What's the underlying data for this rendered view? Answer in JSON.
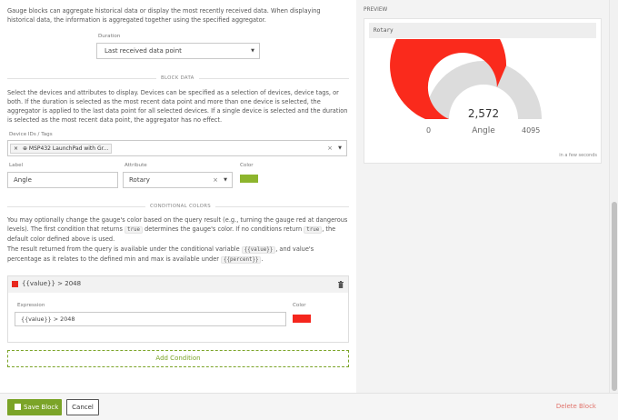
{
  "intro": {
    "text": "Gauge blocks can aggregate historical data or display the most recently received data. When displaying historical data, the information is aggregated together using the specified aggregator."
  },
  "duration": {
    "label": "Duration",
    "value": "Last received data point"
  },
  "block_data": {
    "heading": "BLOCK DATA",
    "description": "Select the devices and attributes to display. Devices can be specified as a selection of devices, device tags, or both. If the duration is selected as the most recent data point and more than one device is selected, the aggregator is applied to the last data point for all selected devices. If a single device is selected and the duration is selected as the most recent data point, the aggregator has no effect.",
    "device_label": "Device IDs / Tags",
    "device_tag_remove": "×",
    "device_tag_icon": "⊕",
    "device_tag": "MSP432 LaunchPad with Gr...",
    "clear_glyph": "×",
    "caret_glyph": "▼",
    "label_label": "Label",
    "label_value": "Angle",
    "attribute_label": "Attribute",
    "attribute_value": "Rotary",
    "color_label": "Color",
    "color": "#8db52d"
  },
  "conditional_colors": {
    "heading": "CONDITIONAL COLORS",
    "p1": {
      "a": "You may optionally change the gauge's color based on the query result (e.g., turning the gauge red at dangerous levels). The first condition that returns ",
      "code1": "true",
      "b": " determines the gauge's color. If no conditions return ",
      "code2": "true",
      "c": ", the default color defined above is used."
    },
    "p2": {
      "a": "The result returned from the query is available under the conditional variable ",
      "code1": "{{value}}",
      "b": ", and value's percentage as it relates to the defined min and max is available under ",
      "code2": "{{percent}}",
      "c": "."
    },
    "condition": {
      "title": "{{value}} > 2048",
      "swatch_color": "#e8281e",
      "expression_label": "Expression",
      "expression_value": "{{value}} > 2048",
      "color_label": "Color",
      "color": "#f5261d",
      "delete_icon": "trash-icon"
    },
    "add_button": "Add Condition"
  },
  "preview": {
    "label": "PREVIEW",
    "title": "Rotary",
    "value_text": "2,572",
    "label_text": "Angle",
    "min_text": "0",
    "max_text": "4095",
    "updated": "in a few seconds",
    "gauge_color": "#fa2a1c",
    "track_color": "#dcdcdc"
  },
  "chart_data": {
    "type": "gauge",
    "title": "Rotary",
    "label": "Angle",
    "value": 2572,
    "min": 0,
    "max": 4095
  },
  "footer": {
    "save_icon": "floppy-icon",
    "save_label": "Save Block",
    "cancel_label": "Cancel",
    "delete_label": "Delete Block"
  },
  "accent_color": "#7ba428"
}
